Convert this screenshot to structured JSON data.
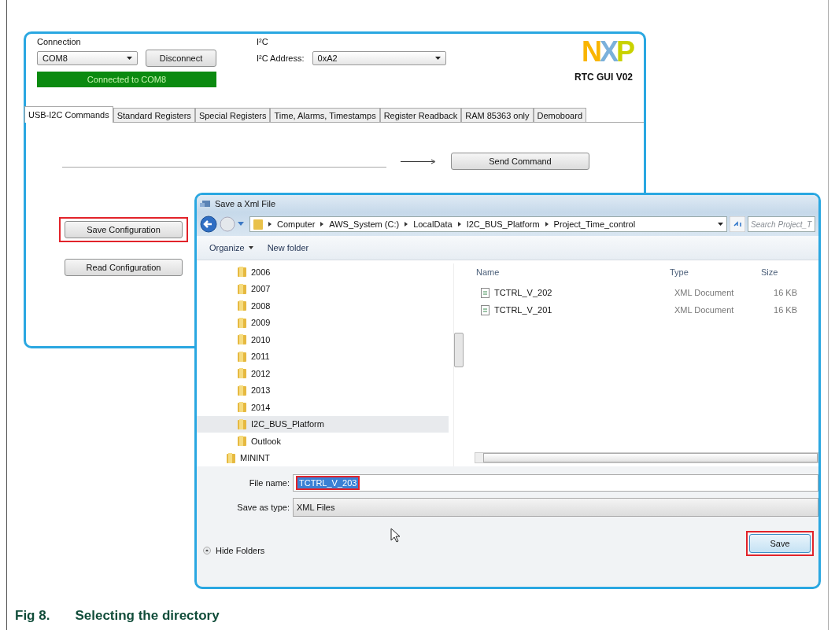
{
  "app_window": {
    "connection_label": "Connection",
    "port": "COM8",
    "disconnect_button": "Disconnect",
    "status": "Connected to COM8",
    "i2c_label": "I²C",
    "address_label": "I²C Address:",
    "address": "0xA2",
    "logo": "NXP",
    "version": "RTC GUI V02",
    "tabs": [
      {
        "label": "USB-I2C Commands",
        "selected": true
      },
      {
        "label": "Standard Registers",
        "selected": false
      },
      {
        "label": "Special Registers",
        "selected": false
      },
      {
        "label": "Time, Alarms, Timestamps",
        "selected": false
      },
      {
        "label": "Register Readback",
        "selected": false
      },
      {
        "label": "RAM 85363 only",
        "selected": false
      },
      {
        "label": "Demoboard",
        "selected": false
      }
    ],
    "send_button": "Send Command",
    "buttons": [
      {
        "label": "Save Configuration",
        "highlighted": true
      },
      {
        "label": "Read Configuration",
        "highlighted": false
      }
    ]
  },
  "save_dialog": {
    "title": "Save a Xml File",
    "breadcrumb": [
      "Computer",
      "AWS_System (C:)",
      "LocalData",
      "I2C_BUS_Platform",
      "Project_Time_control"
    ],
    "search": {
      "placeholder": "Search Project_T"
    },
    "toolbar": [
      {
        "label": "Organize",
        "dropdown": true
      },
      {
        "label": "New folder",
        "dropdown": false
      }
    ],
    "tree": [
      {
        "children": [
          {
            "label": "2006",
            "selected": false
          },
          {
            "label": "2007",
            "selected": false
          },
          {
            "label": "2008",
            "selected": false
          },
          {
            "label": "2009",
            "selected": false
          },
          {
            "label": "2010",
            "selected": false
          },
          {
            "label": "2011",
            "selected": false
          },
          {
            "label": "2012",
            "selected": false
          },
          {
            "label": "2013",
            "selected": false
          },
          {
            "label": "2014",
            "selected": false
          },
          {
            "label": "I2C_BUS_Platform",
            "selected": true
          },
          {
            "label": "Outlook",
            "selected": false
          }
        ]
      },
      {
        "label": "MININT",
        "selected": false
      }
    ],
    "columns": [
      "Name",
      "Type",
      "Size"
    ],
    "files": [
      {
        "name": "TCTRL_V_202",
        "type": "XML Document",
        "size": "16 KB"
      },
      {
        "name": "TCTRL_V_201",
        "type": "XML Document",
        "size": "16 KB"
      }
    ],
    "file_name_label": "File name:",
    "file_name": {
      "value": "TCTRL_V_203",
      "highlighted": true
    },
    "save_type_label": "Save as type:",
    "save_type": "XML Files",
    "hide_folders": "Hide Folders",
    "save_button": {
      "label": "Save",
      "highlighted": true
    }
  },
  "caption": {
    "number": "Fig 8.",
    "title": "Selecting the directory"
  }
}
